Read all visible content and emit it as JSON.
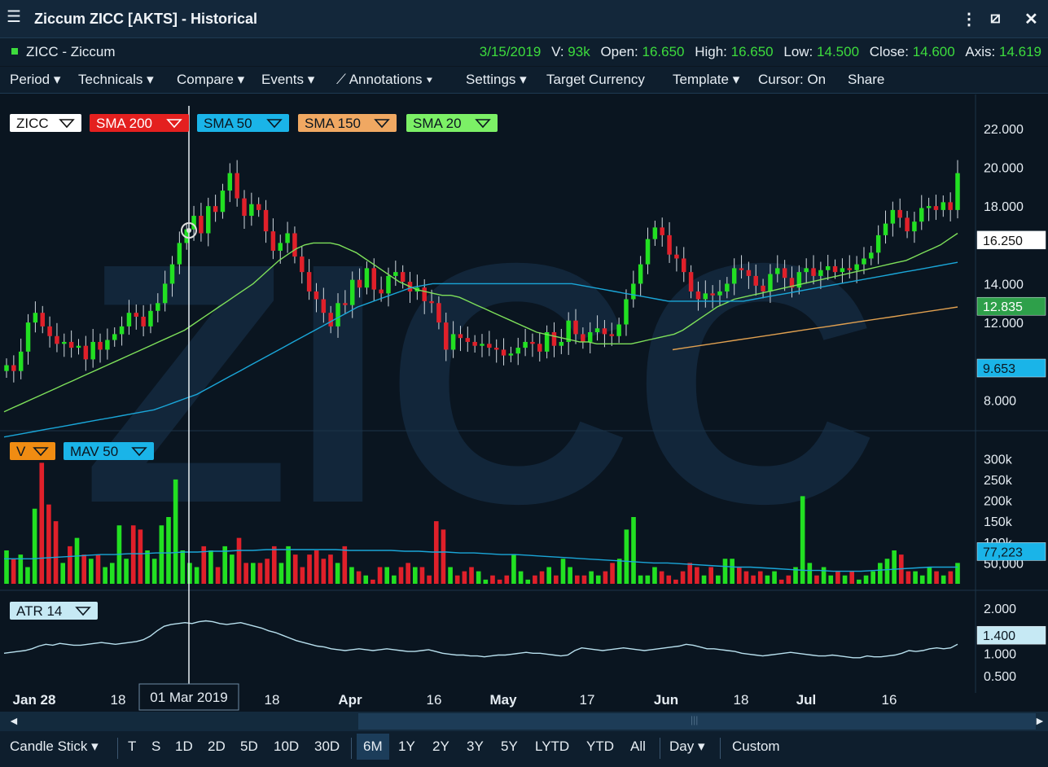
{
  "window": {
    "title": "Ziccum ZICC [AKTS] - Historical"
  },
  "info": {
    "symbol": "ZICC - Ziccum",
    "date": "3/15/2019",
    "v_label": "V:",
    "v_value": "93k",
    "open_label": "Open:",
    "open_value": "16.650",
    "high_label": "High:",
    "high_value": "16.650",
    "low_label": "Low:",
    "low_value": "14.500",
    "close_label": "Close:",
    "close_value": "14.600",
    "axis_label": "Axis:",
    "axis_value": "14.619"
  },
  "toolbar": {
    "period": "Period",
    "technicals": "Technicals",
    "compare": "Compare",
    "events": "Events",
    "annotations": "Annotations",
    "settings": "Settings",
    "target_currency": "Target Currency",
    "template": "Template",
    "cursor": "Cursor: On",
    "share": "Share"
  },
  "colors": {
    "up": "#22e022",
    "down": "#e0202a",
    "sma20": "#7ee05a",
    "sma50": "#1aa6d8",
    "sma150": "#e0a050",
    "atr": "#b8e0ee",
    "mav": "#1aa6d8"
  },
  "chart_data": [
    {
      "type": "candlestick",
      "watermark": "ZICC",
      "legend": [
        "ZICC",
        "SMA 200",
        "SMA 50",
        "SMA 150",
        "SMA 20"
      ],
      "y_ticks": [
        "22.000",
        "20.000",
        "18.000",
        "14.000",
        "12.000",
        "8.000"
      ],
      "ylim": [
        6.8,
        23.0
      ],
      "price_badges": {
        "last": "16.250",
        "sma20": "12.835",
        "sma50": "9.653"
      },
      "x_ticks": [
        "Jan 28",
        "18",
        "18",
        "Apr",
        "16",
        "May",
        "17",
        "Jun",
        "18",
        "Jul",
        "16"
      ],
      "crosshair_label": "01 Mar 2019",
      "close": [
        9.8,
        9.5,
        10.5,
        12.0,
        12.5,
        11.8,
        11.3,
        10.9,
        11.0,
        10.7,
        10.8,
        10.1,
        11.0,
        10.6,
        11.1,
        11.4,
        11.8,
        12.5,
        12.3,
        11.8,
        12.6,
        13.0,
        14.0,
        15.0,
        16.1,
        16.8,
        17.5,
        16.6,
        18.0,
        17.7,
        18.8,
        19.7,
        18.4,
        17.5,
        18.1,
        17.8,
        16.7,
        15.7,
        16.1,
        16.6,
        15.4,
        14.6,
        13.6,
        13.2,
        12.5,
        11.8,
        13.0,
        12.9,
        14.2,
        13.8,
        14.8,
        13.7,
        13.5,
        14.4,
        14.6,
        14.1,
        13.6,
        13.8,
        13.1,
        13.0,
        12.0,
        10.6,
        11.4,
        11.2,
        11.0,
        10.8,
        10.9,
        10.7,
        10.6,
        10.3,
        10.4,
        10.7,
        11.0,
        10.9,
        10.5,
        11.5,
        10.8,
        11.0,
        12.1,
        11.4,
        11.0,
        11.5,
        11.7,
        11.4,
        11.3,
        11.9,
        13.2,
        14.0,
        15.0,
        16.3,
        16.9,
        16.5,
        15.5,
        15.3,
        14.6,
        13.6,
        13.2,
        13.5,
        13.4,
        13.6,
        14.0,
        14.8,
        14.7,
        14.4,
        13.9,
        13.6,
        14.5,
        14.8,
        14.3,
        13.8,
        14.6,
        14.8,
        14.4,
        14.7,
        14.9,
        14.6,
        14.8,
        14.7,
        15.0,
        15.3,
        15.6,
        16.5,
        17.1,
        17.8,
        17.4,
        16.7,
        17.2,
        17.9,
        18.0,
        17.8,
        18.2,
        17.8,
        19.7
      ],
      "sma20": [
        7.4,
        7.6,
        7.8,
        8.0,
        8.2,
        8.4,
        8.6,
        8.8,
        9.0,
        9.2,
        9.4,
        9.6,
        9.8,
        10.0,
        10.2,
        10.4,
        10.6,
        10.8,
        11.0,
        11.2,
        11.4,
        11.6,
        11.9,
        12.2,
        12.5,
        12.8,
        13.1,
        13.4,
        13.7,
        14.0,
        14.4,
        14.8,
        15.2,
        15.5,
        15.8,
        16.0,
        16.1,
        16.1,
        16.1,
        16.0,
        15.8,
        15.6,
        15.3,
        15.0,
        14.7,
        14.4,
        14.1,
        13.9,
        13.7,
        13.6,
        13.5,
        13.4,
        13.4,
        13.3,
        13.1,
        12.9,
        12.7,
        12.5,
        12.3,
        12.1,
        11.9,
        11.7,
        11.5,
        11.4,
        11.3,
        11.2,
        11.1,
        11.0,
        11.0,
        10.9,
        10.9,
        10.9,
        10.9,
        10.9,
        11.0,
        11.1,
        11.2,
        11.3,
        11.4,
        11.6,
        11.9,
        12.2,
        12.5,
        12.8,
        13.0,
        13.2,
        13.3,
        13.4,
        13.5,
        13.6,
        13.7,
        13.8,
        13.9,
        14.0,
        14.1,
        14.2,
        14.3,
        14.4,
        14.5,
        14.6,
        14.7,
        14.8,
        14.9,
        15.0,
        15.1,
        15.2,
        15.4,
        15.6,
        15.8,
        16.0,
        16.3,
        16.6
      ],
      "sma50": [
        6.1,
        6.2,
        6.3,
        6.4,
        6.5,
        6.6,
        6.7,
        6.8,
        6.9,
        7.0,
        7.1,
        7.2,
        7.3,
        7.4,
        7.5,
        7.7,
        7.9,
        8.1,
        8.3,
        8.6,
        8.9,
        9.2,
        9.5,
        9.8,
        10.1,
        10.4,
        10.7,
        11.0,
        11.3,
        11.6,
        11.9,
        12.2,
        12.5,
        12.8,
        13.0,
        13.2,
        13.4,
        13.6,
        13.8,
        13.9,
        14.0,
        14.0,
        14.0,
        14.0,
        14.0,
        14.0,
        14.0,
        14.0,
        14.0,
        14.0,
        14.0,
        14.0,
        14.0,
        14.0,
        13.9,
        13.8,
        13.7,
        13.6,
        13.5,
        13.4,
        13.3,
        13.2,
        13.1,
        13.1,
        13.1,
        13.1,
        13.1,
        13.1,
        13.1,
        13.1,
        13.2,
        13.3,
        13.4,
        13.5,
        13.6,
        13.7,
        13.8,
        13.9,
        14.0,
        14.1,
        14.2,
        14.3,
        14.4,
        14.5,
        14.6,
        14.7,
        14.8,
        14.9,
        15.0,
        15.1
      ],
      "sma150": [
        10.6,
        10.7,
        10.8,
        10.9,
        11.0,
        11.1,
        11.2,
        11.3,
        11.4,
        11.5,
        11.6,
        11.7,
        11.8,
        11.9,
        12.0,
        12.1,
        12.2,
        12.3,
        12.4,
        12.5,
        12.6,
        12.7,
        12.8
      ]
    },
    {
      "type": "bar",
      "legend": [
        "V",
        "MAV 50"
      ],
      "y_ticks": [
        "300k",
        "250k",
        "200k",
        "150k",
        "100k",
        "50,000"
      ],
      "ylim": [
        0,
        320000
      ],
      "mav_badge": "77,223",
      "volume": [
        80,
        60,
        70,
        40,
        180,
        290,
        190,
        150,
        50,
        90,
        110,
        70,
        60,
        70,
        40,
        50,
        140,
        60,
        140,
        130,
        80,
        60,
        140,
        160,
        250,
        80,
        50,
        40,
        90,
        80,
        40,
        90,
        70,
        110,
        50,
        50,
        50,
        60,
        90,
        50,
        90,
        70,
        40,
        70,
        80,
        60,
        70,
        50,
        90,
        40,
        30,
        20,
        10,
        40,
        40,
        20,
        40,
        50,
        40,
        40,
        20,
        150,
        130,
        40,
        20,
        30,
        40,
        30,
        10,
        20,
        10,
        20,
        70,
        30,
        10,
        20,
        30,
        40,
        20,
        60,
        40,
        20,
        20,
        30,
        20,
        30,
        50,
        60,
        130,
        160,
        20,
        20,
        40,
        30,
        20,
        10,
        30,
        50,
        40,
        20,
        40,
        20,
        60,
        60,
        40,
        30,
        20,
        30,
        20,
        30,
        10,
        20,
        40,
        210,
        50,
        20,
        40,
        20,
        30,
        20,
        30,
        10,
        20,
        30,
        50,
        60,
        80,
        70,
        30,
        30,
        20,
        40,
        30,
        20,
        30,
        50
      ],
      "mav50": [
        60,
        60,
        60,
        62,
        64,
        66,
        68,
        70,
        70,
        72,
        72,
        74,
        74,
        76,
        76,
        78,
        78,
        80,
        80,
        82,
        82,
        82,
        82,
        82,
        82,
        80,
        80,
        80,
        80,
        78,
        78,
        76,
        76,
        74,
        74,
        72,
        70,
        70,
        68,
        66,
        64,
        62,
        60,
        58,
        56,
        54,
        52,
        50,
        50,
        48,
        46,
        44,
        42,
        40,
        40,
        38,
        36,
        34,
        32,
        32,
        30,
        30,
        30,
        32,
        34,
        36,
        38,
        40,
        40,
        40
      ]
    },
    {
      "type": "line",
      "legend": [
        "ATR 14"
      ],
      "y_ticks": [
        "2.000",
        "1.400",
        "1.000",
        "0.500"
      ],
      "ylim": [
        0.3,
        2.2
      ],
      "atr_badge": "1.400",
      "atr": [
        1.0,
        1.02,
        1.04,
        1.06,
        1.1,
        1.16,
        1.2,
        1.18,
        1.22,
        1.2,
        1.18,
        1.18,
        1.2,
        1.22,
        1.24,
        1.22,
        1.2,
        1.22,
        1.24,
        1.26,
        1.3,
        1.38,
        1.5,
        1.6,
        1.64,
        1.66,
        1.68,
        1.66,
        1.7,
        1.72,
        1.7,
        1.66,
        1.64,
        1.66,
        1.68,
        1.64,
        1.6,
        1.56,
        1.5,
        1.46,
        1.4,
        1.34,
        1.28,
        1.24,
        1.2,
        1.16,
        1.14,
        1.1,
        1.08,
        1.06,
        1.08,
        1.1,
        1.08,
        1.06,
        1.08,
        1.1,
        1.08,
        1.06,
        1.04,
        1.04,
        1.06,
        1.08,
        1.04,
        1.0,
        0.98,
        0.96,
        0.96,
        0.94,
        0.94,
        0.92,
        0.94,
        0.96,
        0.96,
        0.98,
        1.0,
        1.02,
        1.0,
        1.0,
        0.98,
        0.96,
        0.94,
        0.96,
        1.06,
        1.12,
        1.1,
        1.08,
        1.06,
        1.08,
        1.1,
        1.12,
        1.1,
        1.08,
        1.06,
        1.08,
        1.1,
        1.12,
        1.14,
        1.16,
        1.2,
        1.18,
        1.14,
        1.1,
        1.1,
        1.08,
        1.06,
        1.04,
        1.0,
        0.98,
        0.96,
        0.94,
        0.96,
        0.98,
        1.0,
        1.02,
        1.0,
        0.98,
        0.96,
        0.94,
        0.94,
        0.96,
        0.94,
        0.92,
        0.9,
        0.9,
        0.94,
        0.92,
        0.92,
        0.94,
        0.96,
        1.0,
        1.06,
        1.04,
        1.06,
        1.1,
        1.12,
        1.1,
        1.12,
        1.2
      ]
    }
  ],
  "scroll": {
    "left": "◄",
    "right": "►",
    "grip": "|||"
  },
  "bottombar": {
    "chart_type": "Candle Stick",
    "intervals": [
      "T",
      "S",
      "1D",
      "2D",
      "5D",
      "10D",
      "30D"
    ],
    "ranges": [
      "6M",
      "1Y",
      "2Y",
      "3Y",
      "5Y",
      "LYTD",
      "YTD",
      "All"
    ],
    "selected_range": "6M",
    "frequency": "Day",
    "custom": "Custom"
  }
}
